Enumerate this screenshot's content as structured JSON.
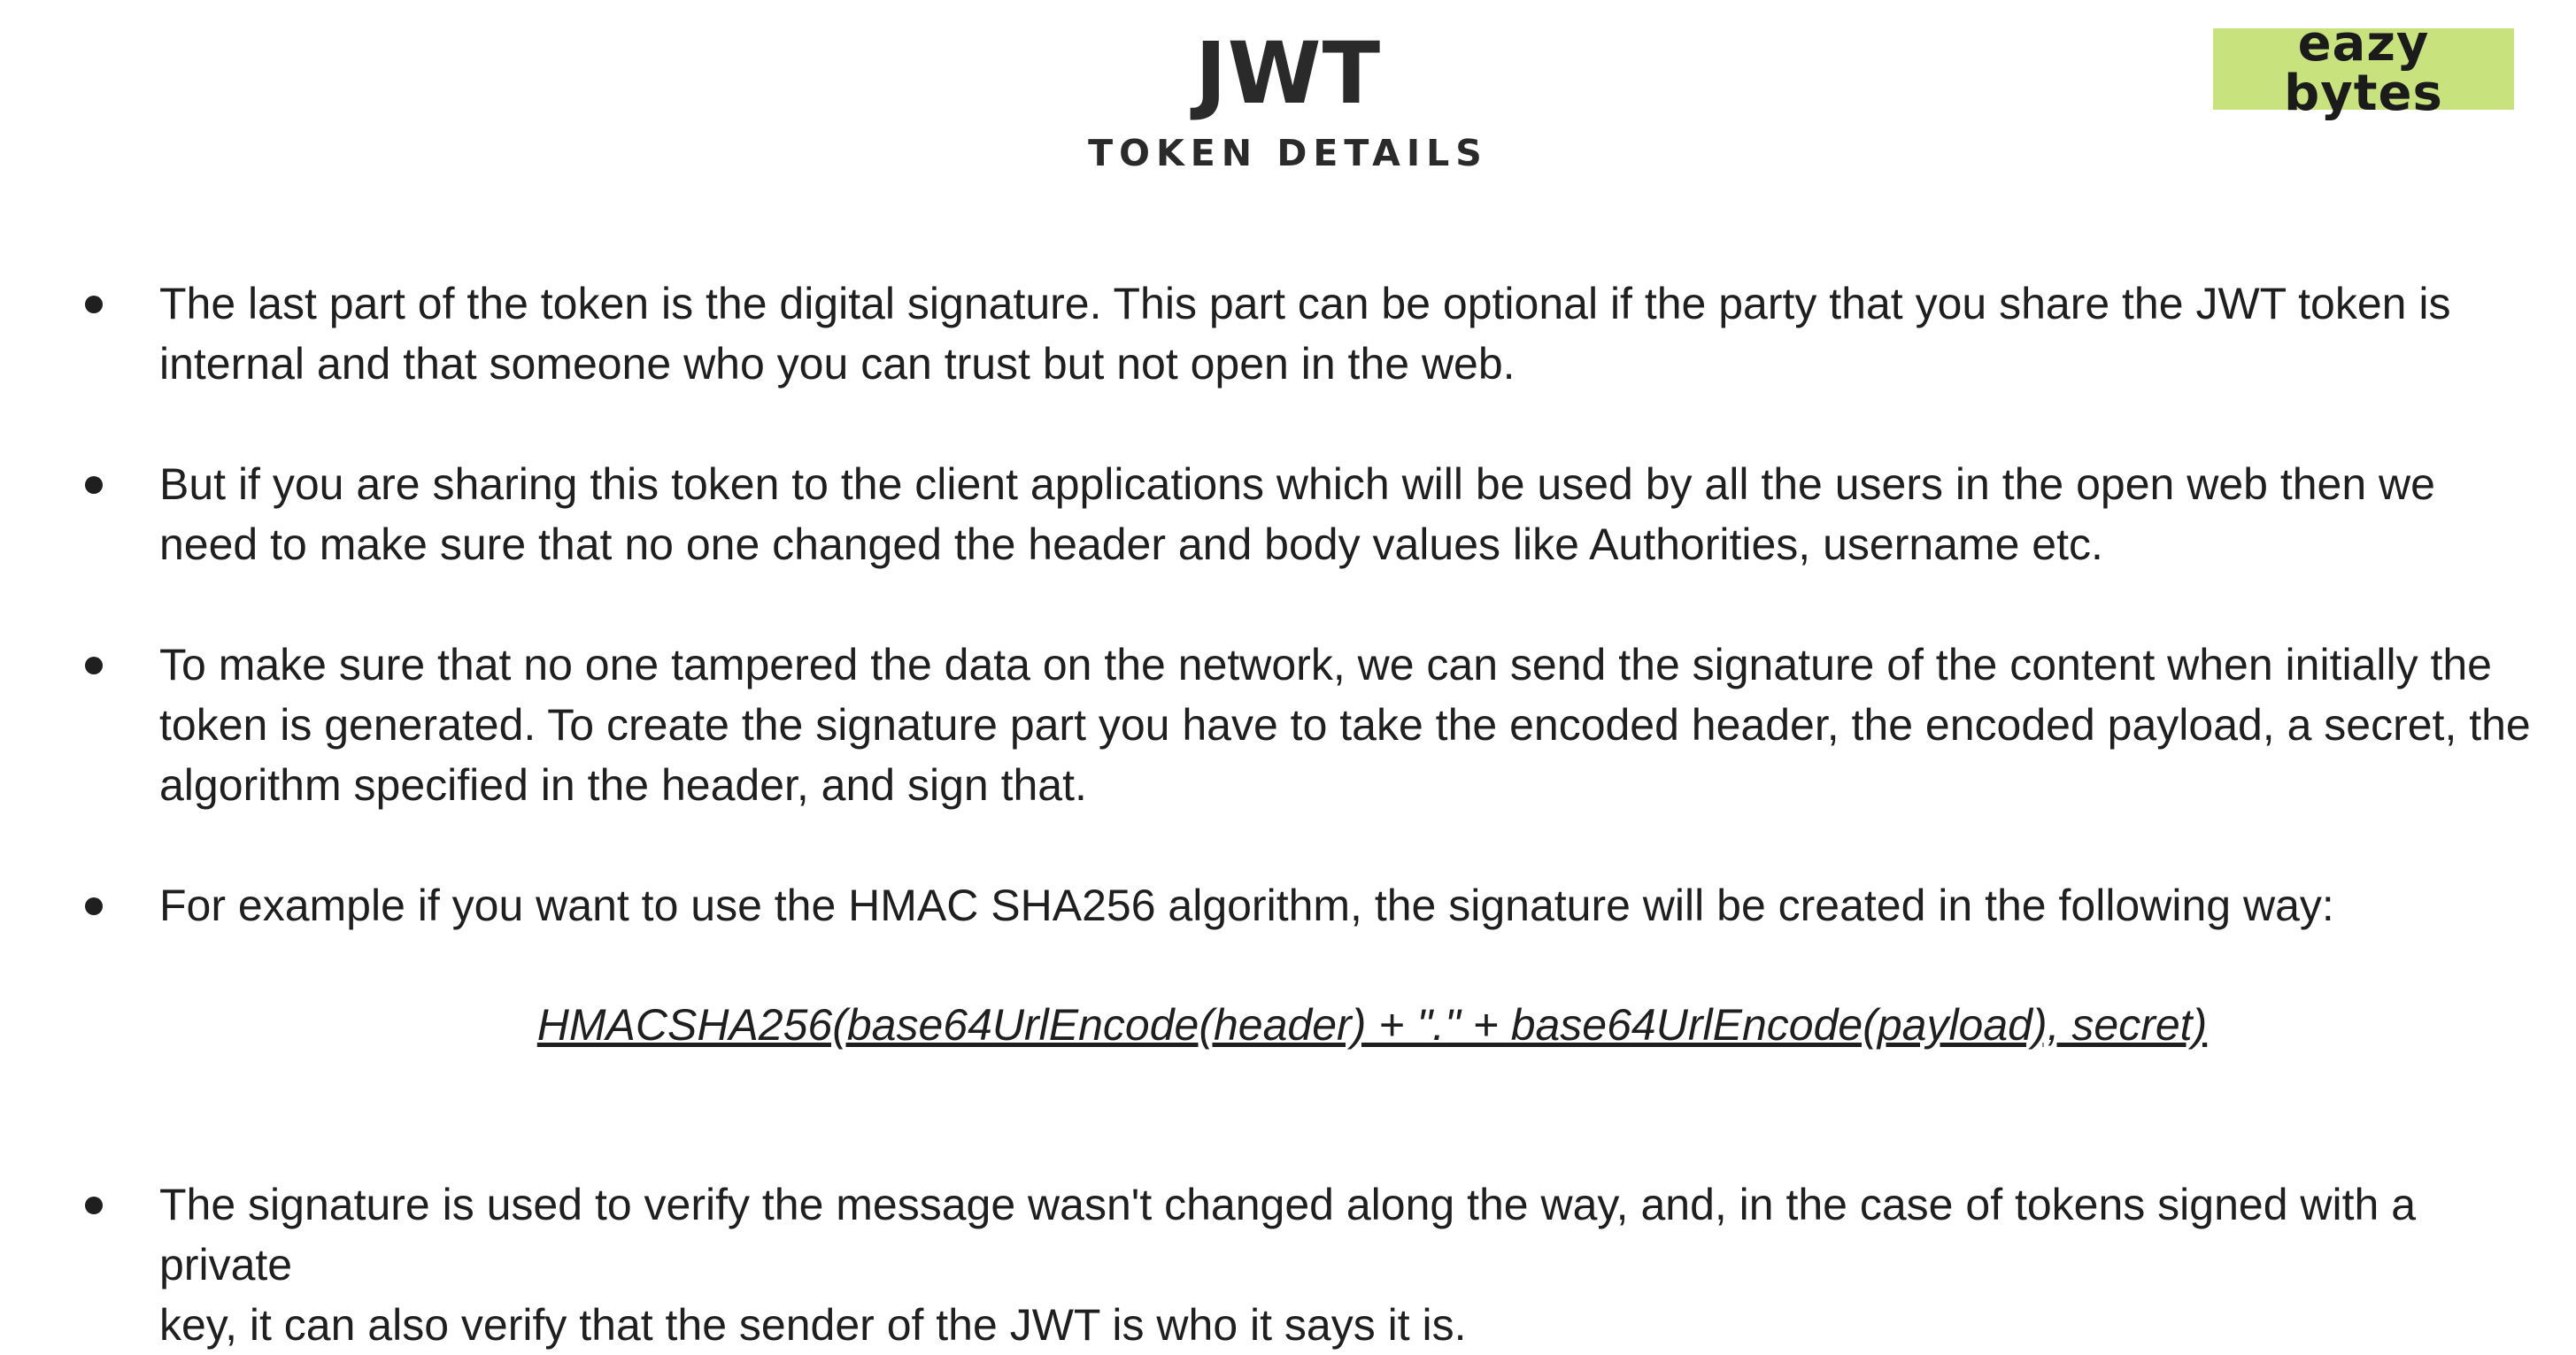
{
  "header": {
    "title": "JWT",
    "subtitle": "TOKEN DETAILS"
  },
  "logo": {
    "line1": "eazy",
    "line2": "bytes",
    "color": "#c8e27e"
  },
  "bullets": [
    {
      "line1": "The last part of the token is the digital signature. This part can be optional if the party that you share the JWT token is",
      "line2": "internal and that someone who you can trust but not open in the web."
    },
    {
      "line1": "But if you are sharing this token to the client applications which will be used by all the users in the open web then we",
      "line2": "need to make sure that no one changed the header and body values like Authorities, username etc."
    },
    {
      "line1": "To make sure that no one tampered the data on the network, we can send the signature of the content when initially the",
      "line2": "token is generated. To create the signature part you have to take the encoded header, the encoded payload, a secret, the",
      "line3": "algorithm specified in the header, and sign that."
    },
    {
      "line1": "For example if you want to use the HMAC SHA256 algorithm, the signature will be created in the following way:"
    },
    {
      "line1": "The signature is used to verify the message wasn't changed along the way, and, in the case of tokens signed with a private",
      "line2": "key, it can also verify that the sender of the JWT is who it says it is."
    }
  ],
  "formula": "HMACSHA256(base64UrlEncode(header) + \".\" + base64UrlEncode(payload), secret)"
}
